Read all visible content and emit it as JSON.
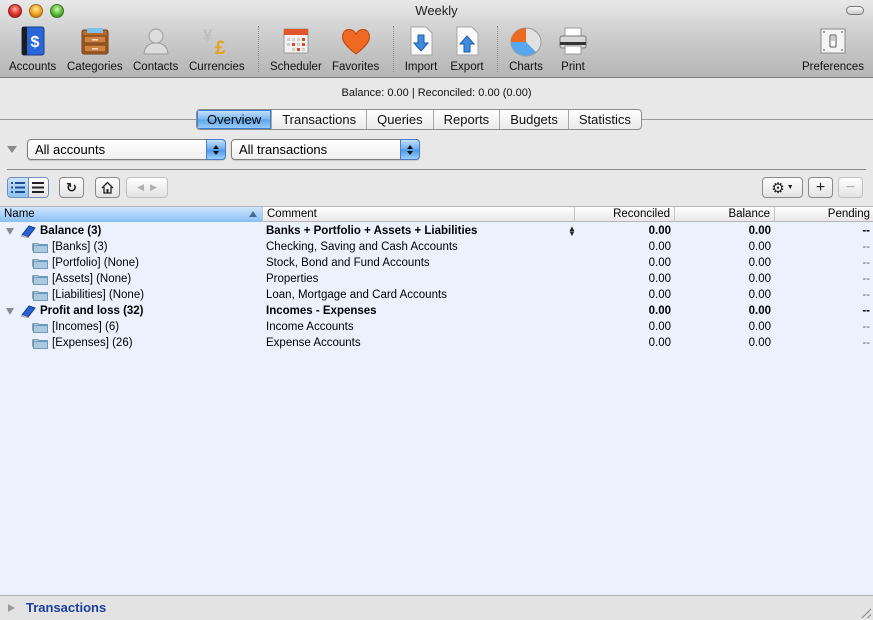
{
  "window": {
    "title": "Weekly"
  },
  "toolbar": {
    "items": [
      {
        "label": "Accounts",
        "icon": "accounts-book-icon"
      },
      {
        "label": "Categories",
        "icon": "categories-drawer-icon"
      },
      {
        "label": "Contacts",
        "icon": "contacts-person-icon"
      },
      {
        "label": "Currencies",
        "icon": "currencies-yen-pound-icon"
      },
      {
        "label": "Scheduler",
        "icon": "scheduler-calendar-icon"
      },
      {
        "label": "Favorites",
        "icon": "favorites-heart-icon"
      },
      {
        "label": "Import",
        "icon": "import-arrow-down-icon"
      },
      {
        "label": "Export",
        "icon": "export-arrow-up-icon"
      },
      {
        "label": "Charts",
        "icon": "charts-pie-icon"
      },
      {
        "label": "Print",
        "icon": "print-printer-icon"
      },
      {
        "label": "Preferences",
        "icon": "preferences-switch-icon"
      }
    ]
  },
  "status": {
    "text": "Balance: 0.00 | Reconciled: 0.00 (0.00)"
  },
  "tabs": {
    "items": [
      "Overview",
      "Transactions",
      "Queries",
      "Reports",
      "Budgets",
      "Statistics"
    ],
    "active": "Overview"
  },
  "filters": {
    "accounts_selected": "All accounts",
    "transactions_selected": "All transactions"
  },
  "table": {
    "columns": [
      "Name",
      "Comment",
      "Reconciled",
      "Balance",
      "Pending"
    ],
    "sorted_column": "Name",
    "sort_direction": "ascending",
    "rows": [
      {
        "name": "Balance (3)",
        "comment": "Banks + Portfolio + Assets + Liabilities",
        "reconciled": "0.00",
        "balance": "0.00",
        "pending": "--",
        "level": 0,
        "expanded": true,
        "bold": true,
        "icon": "book-icon"
      },
      {
        "name": "[Banks] (3)",
        "comment": "Checking, Saving and Cash Accounts",
        "reconciled": "0.00",
        "balance": "0.00",
        "pending": "--",
        "level": 1,
        "expanded": false,
        "bold": false,
        "icon": "folder-icon"
      },
      {
        "name": "[Portfolio] (None)",
        "comment": "Stock, Bond and Fund Accounts",
        "reconciled": "0.00",
        "balance": "0.00",
        "pending": "--",
        "level": 1,
        "expanded": false,
        "bold": false,
        "icon": "folder-icon"
      },
      {
        "name": "[Assets] (None)",
        "comment": "Properties",
        "reconciled": "0.00",
        "balance": "0.00",
        "pending": "--",
        "level": 1,
        "expanded": false,
        "bold": false,
        "icon": "folder-icon"
      },
      {
        "name": "[Liabilities] (None)",
        "comment": "Loan, Mortgage and Card Accounts",
        "reconciled": "0.00",
        "balance": "0.00",
        "pending": "--",
        "level": 1,
        "expanded": false,
        "bold": false,
        "icon": "folder-icon"
      },
      {
        "name": "Profit and loss (32)",
        "comment": "Incomes - Expenses",
        "reconciled": "0.00",
        "balance": "0.00",
        "pending": "--",
        "level": 0,
        "expanded": true,
        "bold": true,
        "icon": "book-icon"
      },
      {
        "name": "[Incomes] (6)",
        "comment": "Income Accounts",
        "reconciled": "0.00",
        "balance": "0.00",
        "pending": "--",
        "level": 1,
        "expanded": false,
        "bold": false,
        "icon": "folder-icon"
      },
      {
        "name": "[Expenses] (26)",
        "comment": "Expense Accounts",
        "reconciled": "0.00",
        "balance": "0.00",
        "pending": "--",
        "level": 1,
        "expanded": false,
        "bold": false,
        "icon": "folder-icon"
      }
    ]
  },
  "bottom_panel": {
    "label": "Transactions",
    "expanded": false
  },
  "colors": {
    "table_background": "#ecf2fd",
    "selected_accent": "#5aa4ea",
    "bottom_label": "#1b3fa0"
  }
}
